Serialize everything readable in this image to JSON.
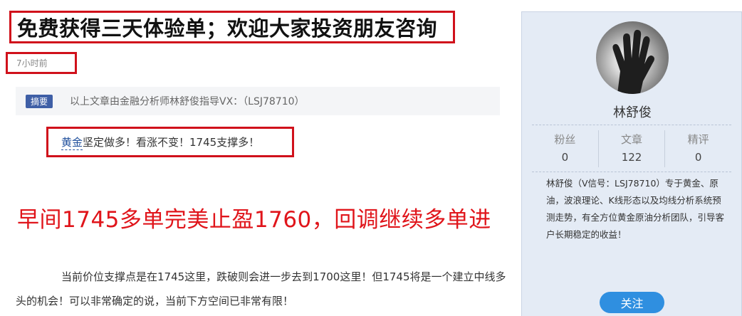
{
  "article": {
    "title": "免费获得三天体验单；欢迎大家投资朋友咨询",
    "time": "7小时前",
    "summary_tag": "摘要",
    "summary_text": "以上文章由金融分析师林舒俊指导VX：（LSJ78710）",
    "quote_link": "黄金",
    "quote_rest": "坚定做多！看涨不变！1745支撑多！",
    "headline": "早间1745多单完美止盈1760，回调继续多单进",
    "paragraph": "当前价位支撑点是在1745这里，跌破则会进一步去到1700这里！但1745将是一个建立中线多头的机会！可以非常确定的说，当前下方空间已非常有限！"
  },
  "author": {
    "name": "林舒俊",
    "stats": [
      {
        "label": "粉丝",
        "value": "0"
      },
      {
        "label": "文章",
        "value": "122"
      },
      {
        "label": "精评",
        "value": "0"
      }
    ],
    "bio": "林舒俊（V信号：LSJ78710）专于黄金、原油，波浪理论、K线形态以及均线分析系统预测走势，有全方位黄金原油分析团队，引导客户长期稳定的收益！",
    "follow_label": "关注"
  },
  "colors": {
    "highlight_border": "#d0111b",
    "headline": "#e0151b",
    "card_bg": "#e4ebf5",
    "follow_btn": "#2f8fe0",
    "tag_bg": "#3f5fa6"
  }
}
